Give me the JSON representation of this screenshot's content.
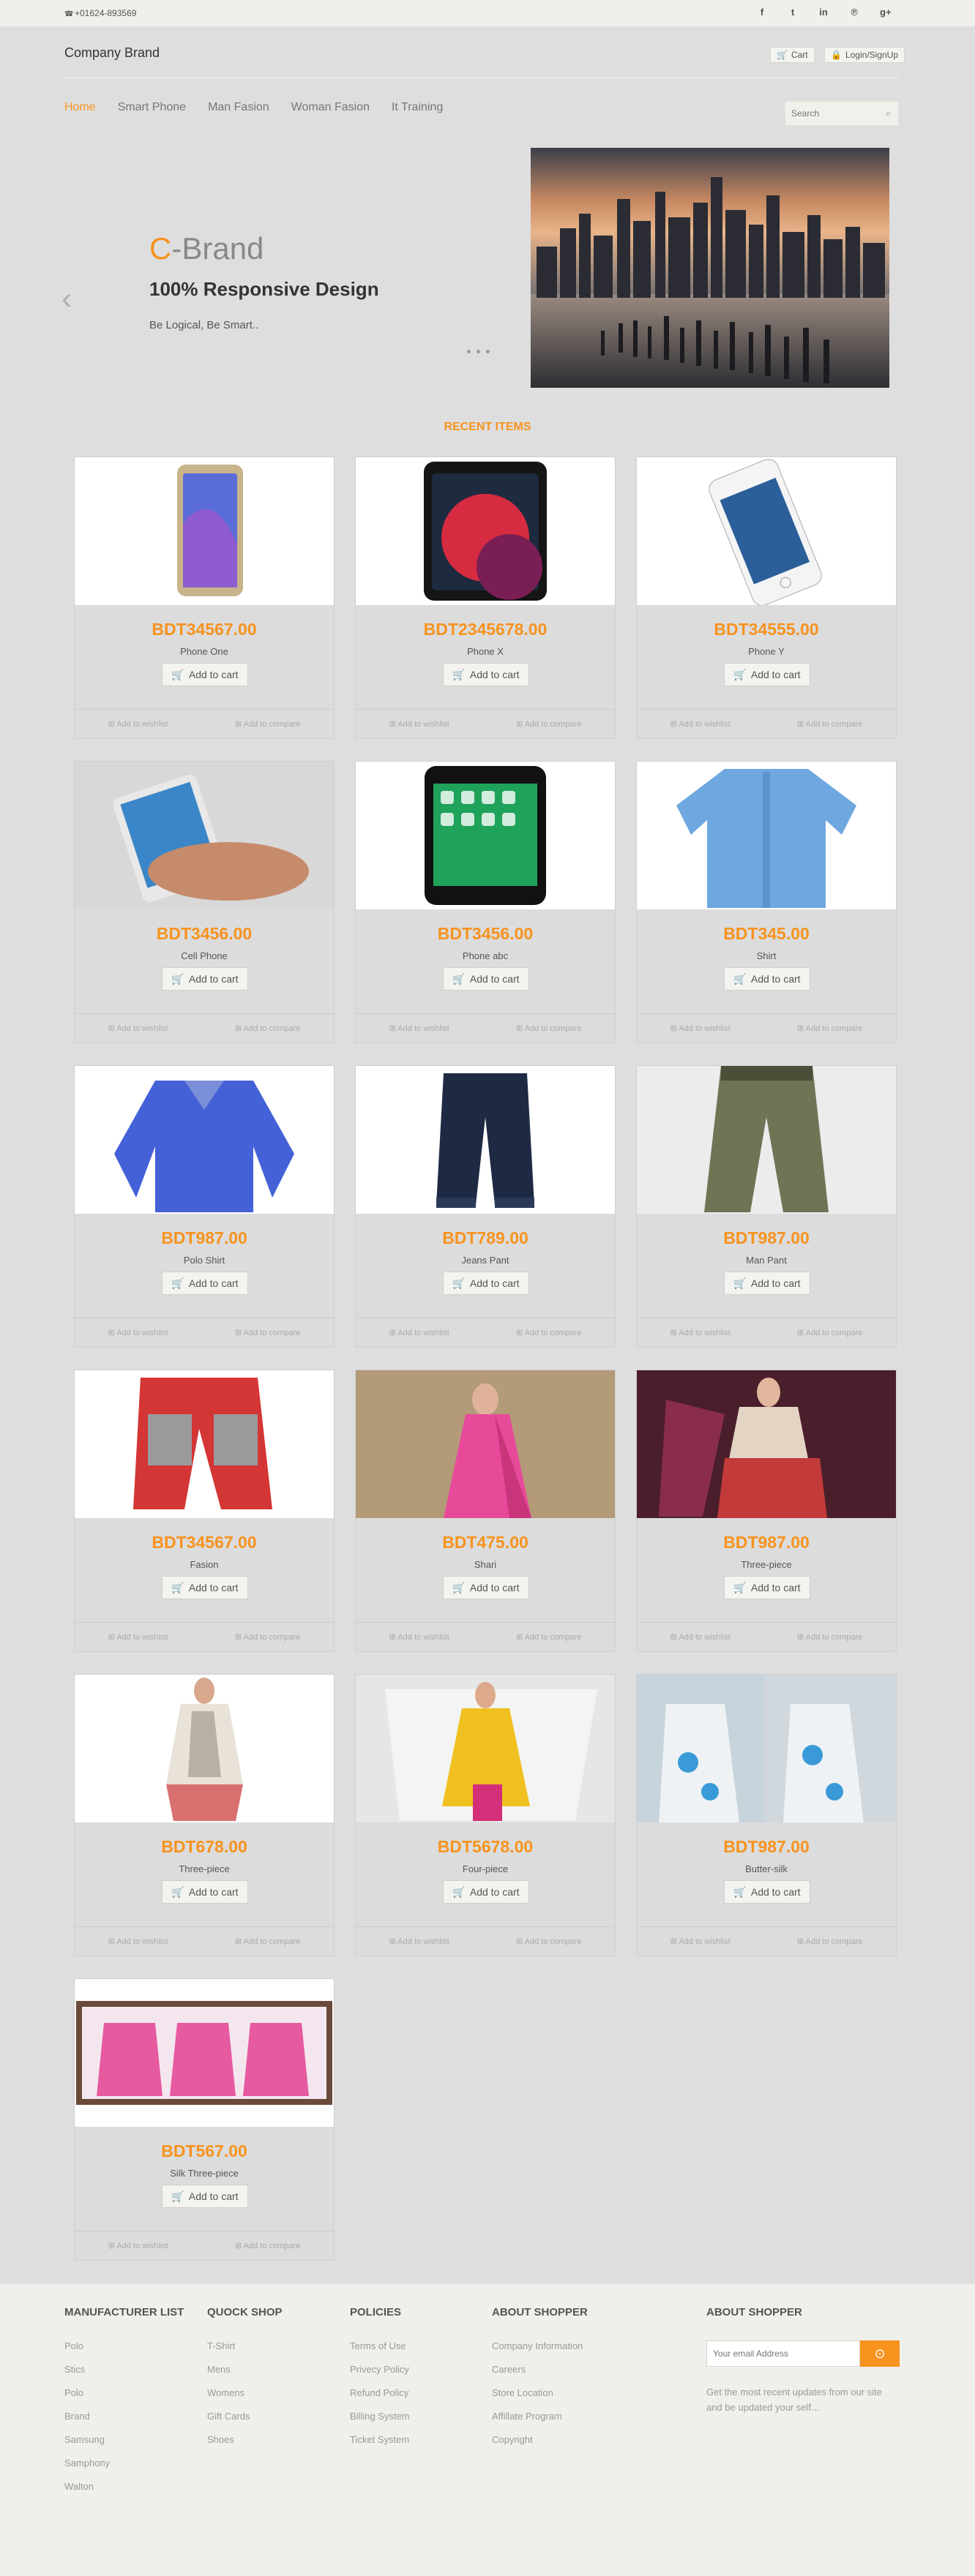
{
  "topbar": {
    "phone": "+01624-893569",
    "social": [
      {
        "icon": "facebook-icon",
        "glyph": "f"
      },
      {
        "icon": "twitter-icon",
        "glyph": "t"
      },
      {
        "icon": "linkedin-icon",
        "glyph": "in"
      },
      {
        "icon": "pinterest-icon",
        "glyph": "℗"
      },
      {
        "icon": "google-plus-icon",
        "glyph": "g+"
      }
    ]
  },
  "header": {
    "brand": "Company Brand",
    "cart": "Cart",
    "login": "Login/SignUp"
  },
  "nav": {
    "items": [
      "Home",
      "Smart Phone",
      "Man Fasion",
      "Woman Fasion",
      "It Training"
    ],
    "search_placeholder": "Search"
  },
  "slider": {
    "title_c": "C",
    "title_rest": "-Brand",
    "subtitle": "100% Responsive Design",
    "text": "Be Logical, Be Smart.."
  },
  "section_title": "RECENT ITEMS",
  "card_labels": {
    "add": "Add to cart",
    "wishlist": "Add to wishlist",
    "compare": "Add to compare"
  },
  "products": [
    {
      "price": "BDT34567.00",
      "name": "Phone One"
    },
    {
      "price": "BDT2345678.00",
      "name": "Phone X"
    },
    {
      "price": "BDT34555.00",
      "name": "Phone Y"
    },
    {
      "price": "BDT3456.00",
      "name": "Cell Phone"
    },
    {
      "price": "BDT3456.00",
      "name": "Phone abc"
    },
    {
      "price": "BDT345.00",
      "name": "Shirt"
    },
    {
      "price": "BDT987.00",
      "name": "Polo Shirt"
    },
    {
      "price": "BDT789.00",
      "name": "Jeans Pant"
    },
    {
      "price": "BDT987.00",
      "name": "Man Pant"
    },
    {
      "price": "BDT34567.00",
      "name": "Fasion"
    },
    {
      "price": "BDT475.00",
      "name": "Shari"
    },
    {
      "price": "BDT987.00",
      "name": "Three-piece"
    },
    {
      "price": "BDT678.00",
      "name": "Three-piece"
    },
    {
      "price": "BDT5678.00",
      "name": "Four-piece"
    },
    {
      "price": "BDT987.00",
      "name": "Butter-silk"
    },
    {
      "price": "BDT567.00",
      "name": "Silk Three-piece"
    }
  ],
  "footer": {
    "manufacturer": {
      "title": "MANUFACTURER LIST",
      "items": [
        "Polo",
        "Stics",
        "Polo",
        "Brand",
        "Samsung",
        "Samphony",
        "Walton"
      ]
    },
    "quick_shop": {
      "title": "QUOCK SHOP",
      "items": [
        "T-Shirt",
        "Mens",
        "Womens",
        "Gift Cards",
        "Shoes"
      ]
    },
    "policies": {
      "title": "POLICIES",
      "items": [
        "Terms of Use",
        "Privecy Policy",
        "Refund Policy",
        "Billing System",
        "Ticket System"
      ]
    },
    "about": {
      "title": "ABOUT SHOPPER",
      "items": [
        "Company Information",
        "Careers",
        "Store Location",
        "Affillate Program",
        "Copyright"
      ]
    },
    "subscribe": {
      "title": "ABOUT SHOPPER",
      "placeholder": "Your email Address",
      "text": "Get the most recent updates from our site and be updated your self..."
    }
  },
  "colors": {
    "accent": "#f7931e",
    "page_bg": "#dedede",
    "footer_bg": "#efefeb"
  }
}
